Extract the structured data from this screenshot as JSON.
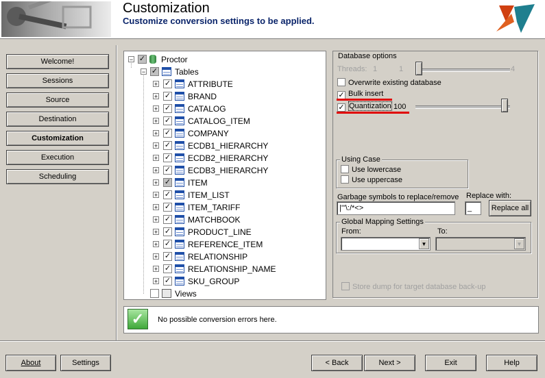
{
  "header": {
    "title": "Customization",
    "subtitle": "Customize conversion settings to be applied."
  },
  "nav": {
    "items": [
      {
        "label": "Welcome!"
      },
      {
        "label": "Sessions"
      },
      {
        "label": "Source"
      },
      {
        "label": "Destination"
      },
      {
        "label": "Customization",
        "active": true
      },
      {
        "label": "Execution"
      },
      {
        "label": "Scheduling"
      }
    ]
  },
  "tree": {
    "root": "Proctor",
    "tables_node": "Tables",
    "tables": [
      "ATTRIBUTE",
      "BRAND",
      "CATALOG",
      "CATALOG_ITEM",
      "COMPANY",
      "ECDB1_HIERARCHY",
      "ECDB2_HIERARCHY",
      "ECDB3_HIERARCHY",
      "ITEM",
      "ITEM_LIST",
      "ITEM_TARIFF",
      "MATCHBOOK",
      "PRODUCT_LINE",
      "REFERENCE_ITEM",
      "RELATIONSHIP",
      "RELATIONSHIP_NAME",
      "SKU_GROUP"
    ],
    "views_node": "Views"
  },
  "options": {
    "database_group": "Database options",
    "threads_label": "Threads:",
    "threads_min": "1",
    "threads_value": "1",
    "threads_max": "4",
    "overwrite_label": "Overwrite existing database",
    "bulk_insert_label": "Bulk insert",
    "quantization_label": "Quantization",
    "quantization_value": "100",
    "using_case_group": "Using Case",
    "lowercase_label": "Use lowercase",
    "uppercase_label": "Use uppercase",
    "garbage_label": "Garbage symbols to replace/remove",
    "garbage_value": "|'\"\\:/*<>",
    "replace_with_label": "Replace with:",
    "replace_with_value": "_",
    "replace_all_label": "Replace all",
    "mapping_group": "Global Mapping Settings",
    "from_label": "From:",
    "to_label": "To:",
    "store_dump_label": "Store dump for target database back-up"
  },
  "status": {
    "message": "No possible conversion errors here."
  },
  "footer": {
    "about": "About",
    "settings": "Settings",
    "back": "< Back",
    "next": "Next >",
    "exit": "Exit",
    "help": "Help"
  }
}
